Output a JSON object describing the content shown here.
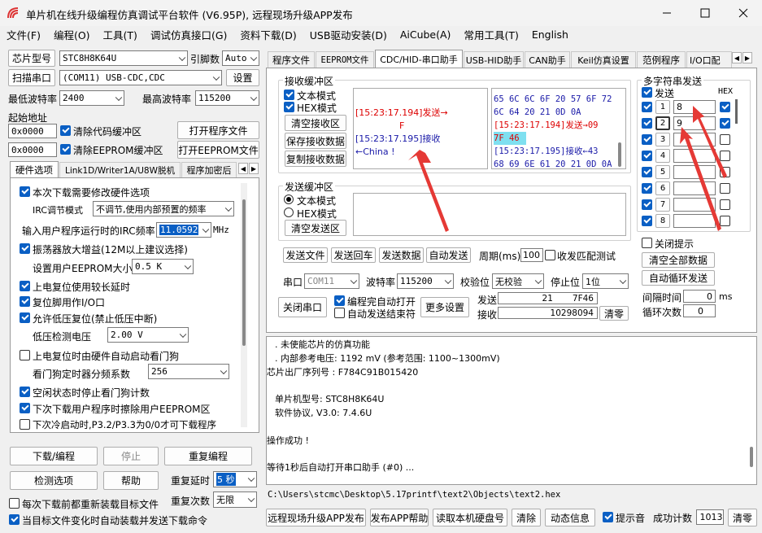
{
  "window": {
    "title": "单片机在线升级编程仿真调试平台软件 (V6.95P), 远程现场升级APP发布"
  },
  "menu": [
    "文件(F)",
    "编程(O)",
    "工具(T)",
    "调试仿真接口(G)",
    "资料下载(D)",
    "USB驱动安装(D)",
    "AiCube(A)",
    "常用工具(T)",
    "English"
  ],
  "left": {
    "chip_label": "芯片型号",
    "chip_value": "STC8H8K64U",
    "pin_label": "引脚数",
    "pin_value": "Auto",
    "scan_btn": "扫描串口",
    "port_value": "(COM11) USB-CDC,CDC",
    "settings_btn": "设置",
    "minbaud_label": "最低波特率",
    "minbaud_value": "2400",
    "maxbaud_label": "最高波特率",
    "maxbaud_value": "115200",
    "start_addr_label": "起始地址",
    "addr1": "0x0000",
    "clear_code": "清除代码缓冲区",
    "open_prog_btn": "打开程序文件",
    "addr2": "0x0000",
    "clear_eeprom": "清除EEPROM缓冲区",
    "open_eeprom_btn": "打开EEPROM文件",
    "tabs": [
      "硬件选项",
      "Link1D/Writer1A/U8W脱机",
      "程序加密后"
    ],
    "hw": {
      "opt1": "本次下载需要修改硬件选项",
      "irc_mode_label": "IRC调节模式",
      "irc_mode_value": "不调节,使用内部预置的频率",
      "irc_freq_label": "输入用户程序运行时的IRC频率",
      "irc_freq_value": "11.0592",
      "irc_unit": "MHz",
      "osc": "振荡器放大增益(12M以上建议选择)",
      "eeprom_size_label": "设置用户EEPROM大小",
      "eeprom_size_value": "0.5 K",
      "opt_reset_delay": "上电复位使用较长延时",
      "opt_reset_io": "复位脚用作I/O口",
      "opt_lowv": "允许低压复位(禁止低压中断)",
      "lowv_label": "低压检测电压",
      "lowv_value": "2.00 V",
      "opt_wdt": "上电复位时由硬件自动启动看门狗",
      "wdt_label": "看门狗定时器分频系数",
      "wdt_value": "256",
      "opt_idle": "空闲状态时停止看门狗计数",
      "opt_erase": "下次下载用户程序时擦除用户EEPROM区",
      "opt_cold": "下次冷启动时,P3.2/P3.3为0/0才可下载程序"
    },
    "download_btn": "下载/编程",
    "stop_btn": "停止",
    "reprogram_btn": "重复编程",
    "check_btn": "检测选项",
    "help_btn": "帮助",
    "repeat_delay_label": "重复延时",
    "repeat_delay_value": "5 秒",
    "repeat_count_label": "重复次数",
    "repeat_count_value": "无限",
    "reload_label": "每次下载前都重新装载目标文件",
    "autoload_label": "当目标文件变化时自动装载并发送下载命令"
  },
  "right": {
    "tabs": [
      "程序文件",
      "EEPROM文件",
      "CDC/HID-串口助手",
      "USB-HID助手",
      "CAN助手",
      "Keil仿真设置",
      "范例程序",
      "I/O口配"
    ],
    "recv": {
      "title": "接收缓冲区",
      "text_mode": "文本模式",
      "hex_mode": "HEX模式",
      "clear_btn": "清空接收区",
      "save_btn": "保存接收数据",
      "copy_btn": "复制接收数据",
      "text_lines": [
        "[15:23:17.194]发送→",
        "F",
        "[15:23:17.195]接收",
        "←China !"
      ],
      "hex_lines": [
        "65 6C 6C 6F 20 57 6F 72",
        "6C 64 20 21 0D 0A",
        "[15:23:17.194]发送→09",
        "7F 46",
        "[15:23:17.195]接收←43",
        "68 69 6E 61 20 21 0D 0A"
      ]
    },
    "send": {
      "title": "发送缓冲区",
      "text_mode": "文本模式",
      "hex_mode": "HEX模式",
      "clear_btn": "清空发送区",
      "file_btn": "发送文件",
      "enter_btn": "发送回车",
      "data_btn": "发送数据",
      "auto_btn": "自动发送",
      "period_label": "周期(ms)",
      "period_value": "100",
      "match_label": "收发匹配测试"
    },
    "multi": {
      "title": "多字符串发送",
      "send_label": "发送",
      "hex_label": "HEX",
      "rows": [
        {
          "n": "1",
          "v": "8"
        },
        {
          "n": "2",
          "v": "9"
        },
        {
          "n": "3",
          "v": ""
        },
        {
          "n": "4",
          "v": ""
        },
        {
          "n": "5",
          "v": ""
        },
        {
          "n": "6",
          "v": ""
        },
        {
          "n": "7",
          "v": ""
        },
        {
          "n": "8",
          "v": ""
        }
      ],
      "close_tip": "关闭提示",
      "clear_all_btn": "清空全部数据",
      "auto_loop_btn": "自动循环发送",
      "interval_label": "间隔时间",
      "interval_value": "0",
      "interval_unit": "ms",
      "loop_label": "循环次数",
      "loop_value": "0"
    },
    "serial": {
      "port_label": "串口",
      "port_value": "COM11",
      "baud_label": "波特率",
      "baud_value": "115200",
      "parity_label": "校验位",
      "parity_value": "无校验",
      "stop_label": "停止位",
      "stop_value": "1位",
      "close_btn": "关闭串口",
      "auto_open": "编程完自动打开",
      "auto_end": "自动发送结束符",
      "more_btn": "更多设置",
      "send_label": "发送",
      "send_count": "21",
      "send_hex": "7F46",
      "recv_label": "接收",
      "recv_count": "10298094",
      "clear_btn": "清零"
    },
    "log": [
      ". 未使能芯片的仿真功能",
      ". 内部参考电压: 1192 mV (参考范围: 1100~1300mV)",
      "芯片出厂序列号 : F784C91B015420",
      "",
      "单片机型号: STC8H8K64U",
      "软件协议, V3.0: 7.4.6U",
      "",
      "操作成功 !",
      "",
      "等待1秒后自动打开串口助手 (#0) ..."
    ],
    "path": "C:\\Users\\stcmc\\Desktop\\5.17printf\\text2\\Objects\\text2.hex",
    "bottom": {
      "publish_btn": "远程现场升级APP发布",
      "help_btn": "发布APP帮助",
      "read_btn": "读取本机硬盘号",
      "clear_btn": "清除",
      "anim_btn": "动态信息",
      "tone_label": "提示音",
      "success_label": "成功计数",
      "success_value": "1013",
      "reset_btn": "清零"
    }
  }
}
